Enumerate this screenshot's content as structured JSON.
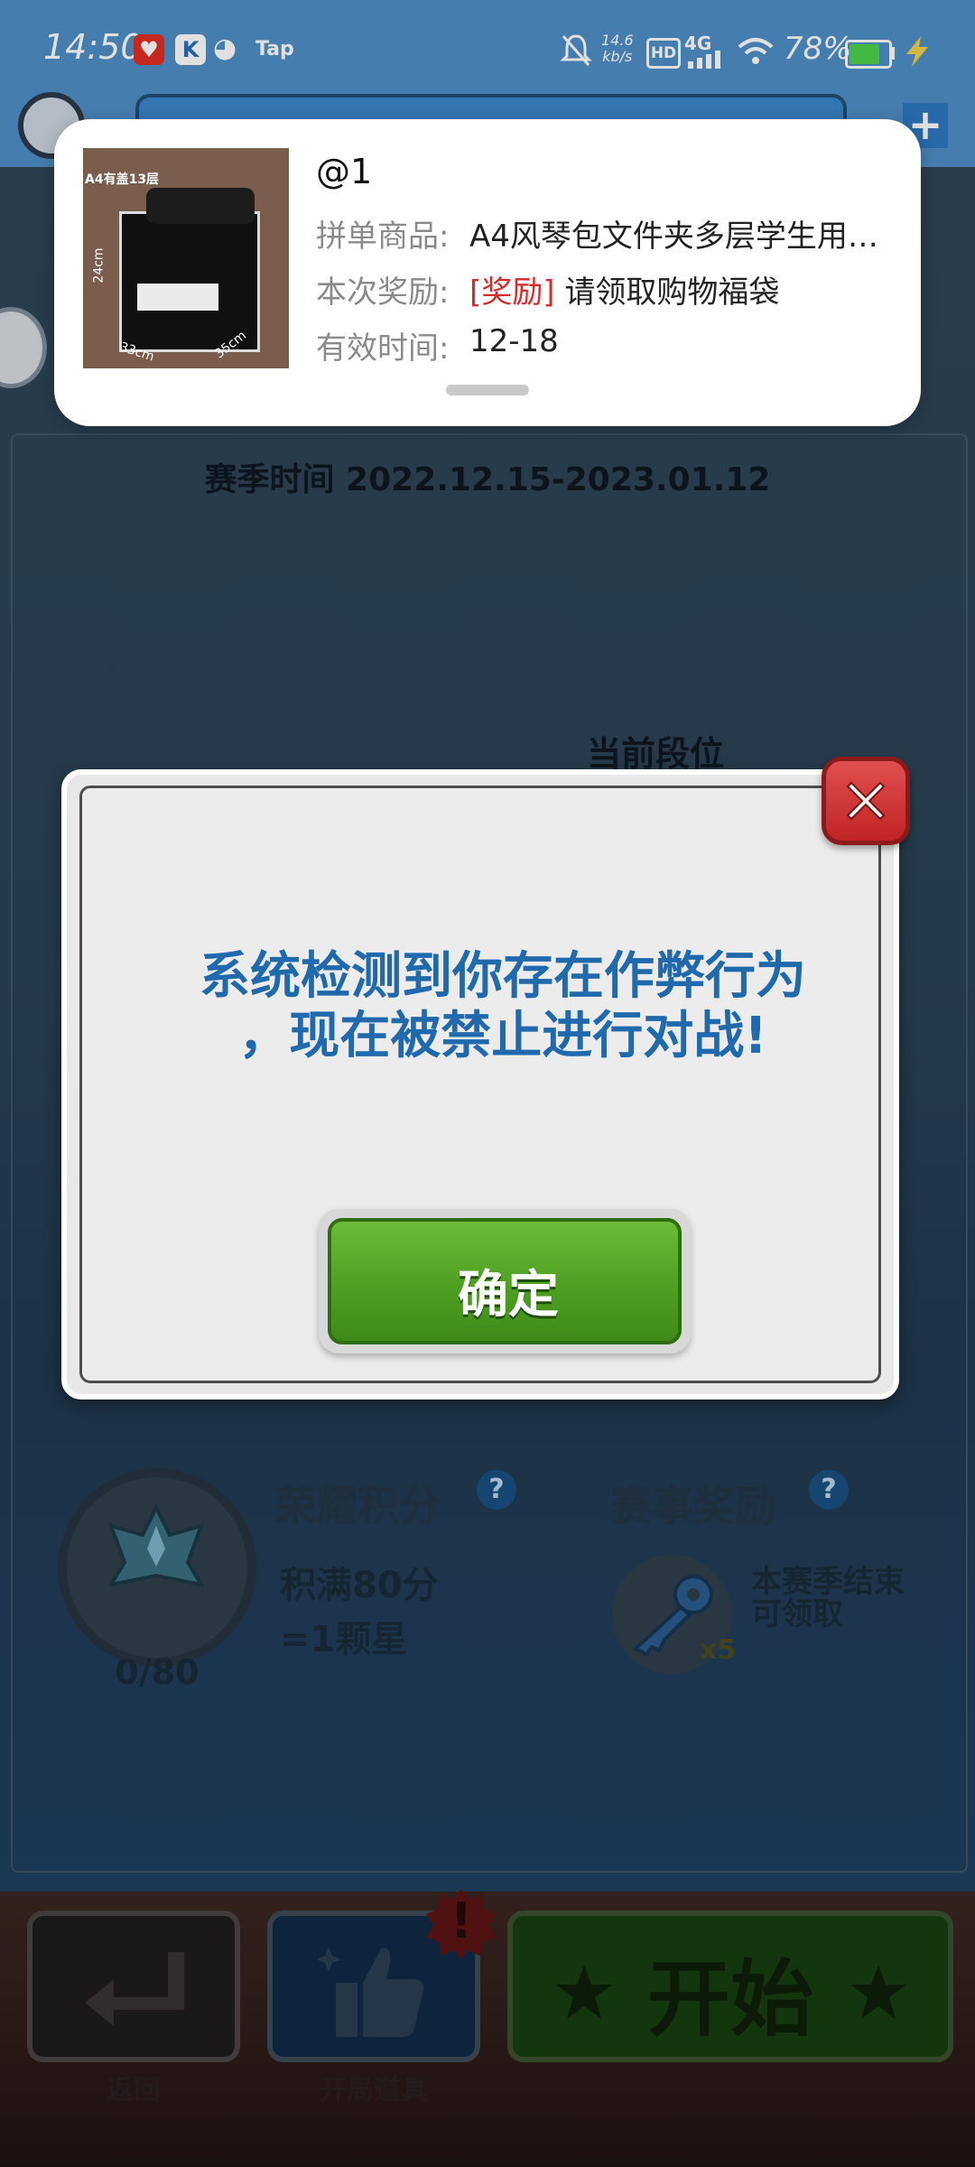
{
  "status_bar": {
    "time": "14:50",
    "tap_label": "Tap",
    "net_speed_value": "14.6",
    "net_speed_unit": "kb/s",
    "hd_label": "HD",
    "net_type": "4G",
    "battery_percent": "78%",
    "battery_level": 0.78,
    "battery_color": "#4dd34d"
  },
  "notification": {
    "user": "@1",
    "image_caption": "A4有盖13层",
    "image_dims": [
      "24cm",
      "33cm",
      "35cm"
    ],
    "product_label": "拼单商品:",
    "product_value": "A4风琴包文件夹多层学生用…",
    "reward_label": "本次奖励:",
    "reward_tag": "[奖励]",
    "reward_value": "请领取购物福袋",
    "valid_label": "有效时间:",
    "valid_value": "12-18"
  },
  "game": {
    "season_time": "赛季时间 2022.12.15-2023.01.12",
    "current_rank": "当前段位",
    "honor_title": "荣耀积分",
    "honor_progress": "0/80",
    "honor_desc_line1": "积满80分",
    "honor_desc_line2": "=1颗星",
    "reward_title": "赛事奖励",
    "key_count": "x5",
    "reward_desc_line1": "本赛季结束",
    "reward_desc_line2": "可领取",
    "help_symbol": "?"
  },
  "bottom_bar": {
    "back_label": "返回",
    "props_label": "开局道具",
    "start_label": "开始",
    "alert_symbol": "!"
  },
  "dialog": {
    "message_line1": "系统检测到你存在作弊行为",
    "message_line2": "，现在被禁止进行对战!",
    "confirm_label": "确定",
    "accent_color": "#2169ad"
  }
}
